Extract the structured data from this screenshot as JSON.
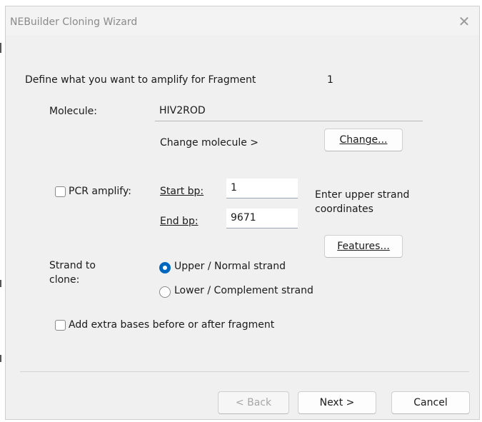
{
  "window": {
    "title": "NEBuilder Cloning Wizard",
    "close_icon": "close-icon"
  },
  "prompt": {
    "text": "Define what you want to amplify for Fragment",
    "fragment_number": "1"
  },
  "molecule": {
    "label": "Molecule:",
    "value": "HIV2ROD",
    "change_text": "Change molecule  >",
    "change_button": "Change..."
  },
  "pcr": {
    "checkbox_label": "PCR amplify:",
    "checked": false,
    "start_label": "Start bp:",
    "start_value": "1",
    "end_label": "End bp:",
    "end_value": "9671",
    "hint_line1": "Enter upper strand",
    "hint_line2": "coordinates",
    "features_button": "Features..."
  },
  "strand": {
    "label_line1": "Strand to",
    "label_line2": "clone:",
    "options": [
      {
        "label": "Upper / Normal strand",
        "selected": true
      },
      {
        "label": "Lower / Complement strand",
        "selected": false
      }
    ]
  },
  "extra_bases": {
    "label": "Add extra bases before or after fragment",
    "checked": false
  },
  "footer": {
    "back_button": "< Back",
    "next_button": "Next >",
    "cancel_button": "Cancel"
  },
  "colors": {
    "accent": "#0067c0",
    "window_bg": "#f0f0f0"
  }
}
